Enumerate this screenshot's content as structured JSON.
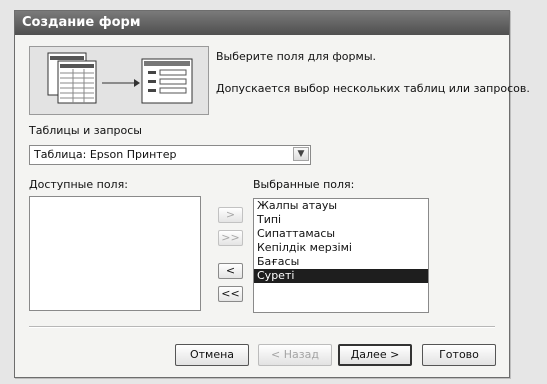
{
  "window": {
    "title": "Создание форм"
  },
  "header": {
    "instruction": "Выберите поля для формы.",
    "hint": "Допускается выбор нескольких таблиц или запросов."
  },
  "source": {
    "label": "Таблицы и запросы",
    "selected": "Таблица: Epson Принтер"
  },
  "available": {
    "label": "Доступные поля:",
    "items": []
  },
  "selected_fields": {
    "label": "Выбранные поля:",
    "items": [
      "Жалпы атауы",
      "Типі",
      "Сипаттамасы",
      "Кепілдік мерзімі",
      "Бағасы",
      "Суреті"
    ],
    "highlighted": "Суреті"
  },
  "move_buttons": {
    "add_one": ">",
    "add_all": ">>",
    "remove_one": "<",
    "remove_all": "<<"
  },
  "footer": {
    "cancel": "Отмена",
    "back": "< Назад",
    "next": "Далее >",
    "finish": "Готово"
  }
}
